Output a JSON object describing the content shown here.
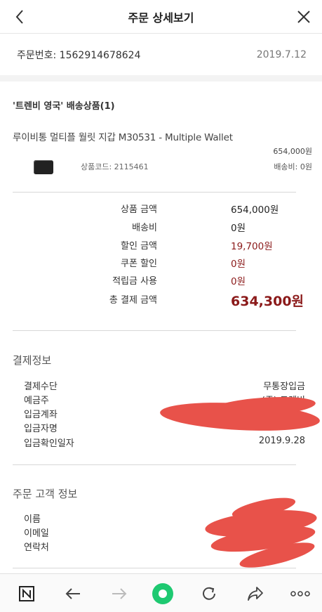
{
  "header": {
    "title": "주문 상세보기"
  },
  "order": {
    "number": "주문번호: 1562914678624",
    "date": "2019.7.12"
  },
  "shop": {
    "name": "'트렌비 영국' 배송상품(1)"
  },
  "product": {
    "name": "루이비통 멀티플 월릿 지갑 M30531 - Multiple Wallet",
    "price": "654,000원",
    "code": "상품코드: 2115461",
    "shipping": "배송비: 0원"
  },
  "summary": [
    {
      "label": "상품 금액",
      "value": "654,000원"
    },
    {
      "label": "배송비",
      "value": "0원"
    },
    {
      "label": "할인 금액",
      "value": "19,700원"
    },
    {
      "label": "쿠폰 할인",
      "value": "0원"
    },
    {
      "label": "적립금 사용",
      "value": "0원"
    },
    {
      "label": "총 결제 금액",
      "value": "634,300원"
    }
  ],
  "payment": {
    "title": "결제정보",
    "rows": [
      {
        "label": "결제수단",
        "value": "무통장입금"
      },
      {
        "label": "예금주",
        "value": "(주) 트렌비"
      },
      {
        "label": "입금계좌",
        "value": ""
      },
      {
        "label": "입금자명",
        "value": ""
      },
      {
        "label": "입금확인일자",
        "value": "2019.9.28"
      }
    ]
  },
  "customer": {
    "title": "주문 고객 정보",
    "rows": [
      {
        "label": "이름"
      },
      {
        "label": "이메일"
      },
      {
        "label": "연락처"
      }
    ]
  },
  "colors": {
    "accent_red": "#8b1a1a",
    "redaction": "#e8524a",
    "home_green": "#1ec971"
  },
  "bottom_nav": [
    "naver-icon",
    "back-arrow-icon",
    "forward-arrow-icon",
    "home-circle-icon",
    "refresh-icon",
    "share-icon",
    "more-icon"
  ]
}
